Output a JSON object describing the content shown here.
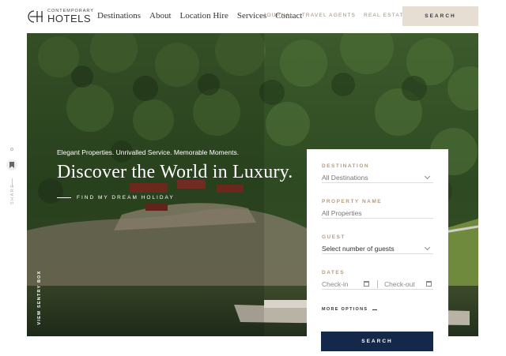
{
  "brand": {
    "small_text": "CONTEMPORARY",
    "name": "HOTELS",
    "logo_icon": "ch-monogram-icon"
  },
  "nav": {
    "main": [
      "Destinations",
      "About",
      "Location Hire",
      "Services",
      "Contact"
    ],
    "secondary": [
      "JOURNAL",
      "TRAVEL AGENTS",
      "REAL ESTATE"
    ],
    "search_label": "SEARCH"
  },
  "social": {
    "share_label": "SHARE",
    "icon": "bookmark-icon"
  },
  "hero": {
    "tagline": "Elegant Properties. Unrivalled Service. Memorable Moments.",
    "title": "Discover the World in Luxury.",
    "cta": "FIND MY DREAM HOLIDAY",
    "virtual_tour": "VIEW SENTRY BOX"
  },
  "booking": {
    "destination_label": "DESTINATION",
    "destination_value": "All Destinations",
    "property_label": "PROPERTY NAME",
    "property_placeholder": "All Properties",
    "guest_label": "GUEST",
    "guest_value": "Select number of guests",
    "dates_label": "DATES",
    "checkin_placeholder": "Check-in",
    "checkout_placeholder": "Check-out",
    "more_options": "MORE OPTIONS",
    "search_label": "SEARCH"
  },
  "colors": {
    "accent_gold": "#b49c7c",
    "header_button": "#e6ddd3",
    "primary_navy": "#14284a"
  }
}
